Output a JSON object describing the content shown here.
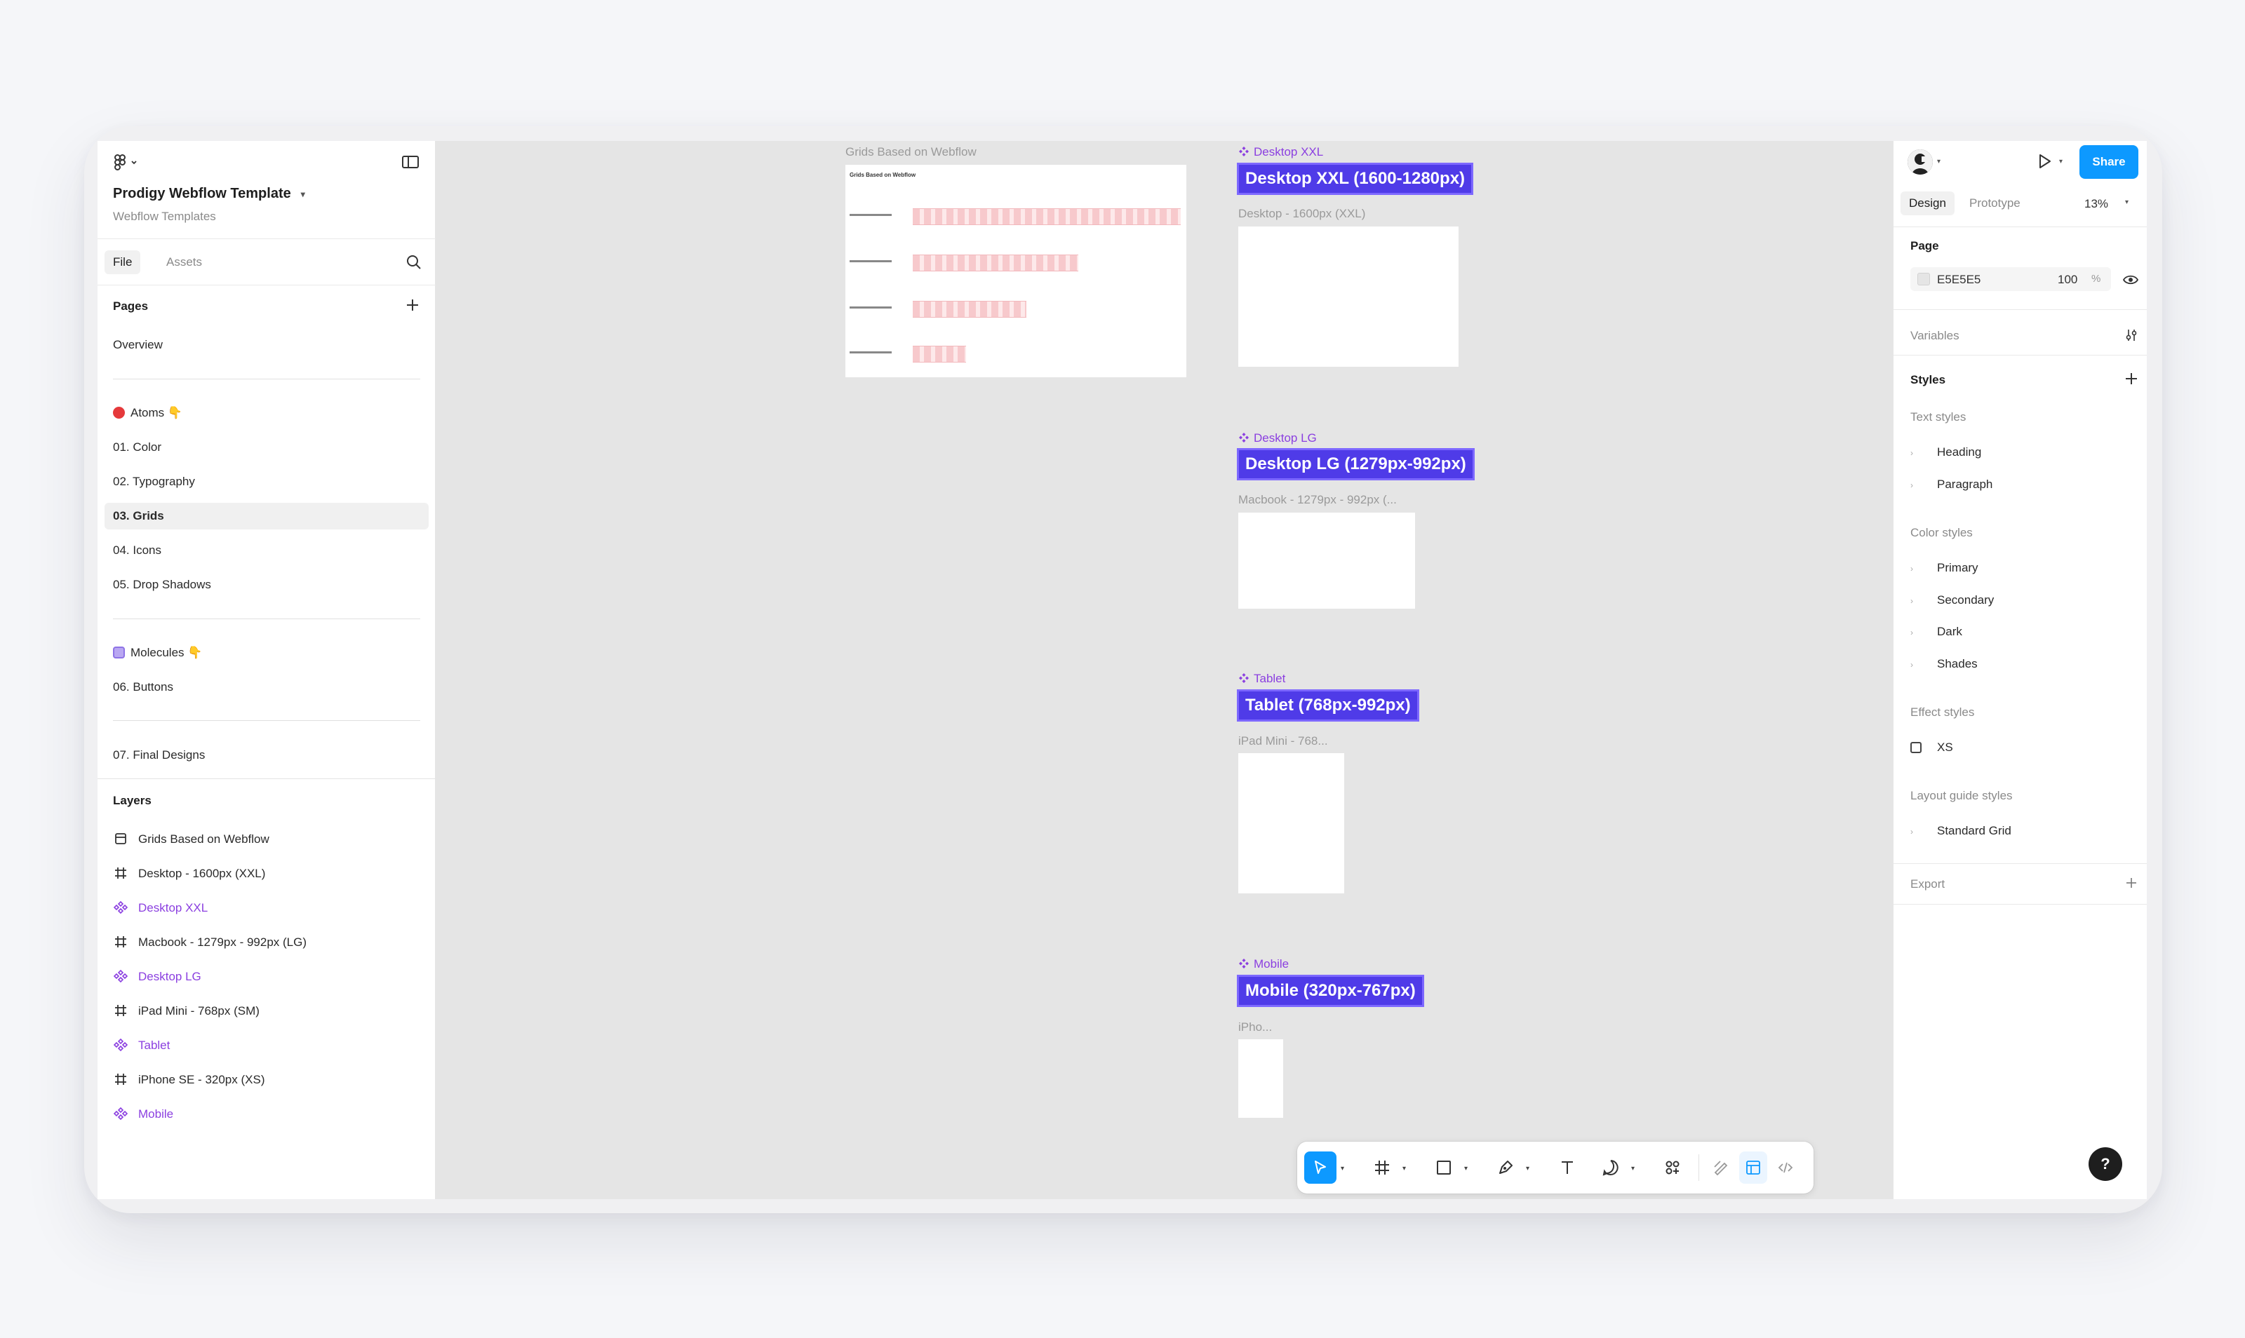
{
  "left_panel": {
    "file_title": "Prodigy Webflow Template",
    "file_subtitle": "Webflow Templates",
    "tabs": [
      "File",
      "Assets"
    ],
    "pages_heading": "Pages",
    "pages": [
      {
        "label": "Overview"
      },
      {
        "label": "Atoms 👇"
      },
      {
        "label": "01. Color"
      },
      {
        "label": "02. Typography"
      },
      {
        "label": "03. Grids",
        "selected": true
      },
      {
        "label": "04. Icons"
      },
      {
        "label": "05.  Drop Shadows"
      },
      {
        "label": "Molecules 👇"
      },
      {
        "label": "06. Buttons"
      },
      {
        "label": "07. Final Designs"
      }
    ],
    "layers_heading": "Layers",
    "layers": [
      {
        "label": "Grids Based on Webflow",
        "icon": "section-icon"
      },
      {
        "label": "Desktop - 1600px (XXL)",
        "icon": "frame-icon"
      },
      {
        "label": "Desktop XXL",
        "icon": "component-icon"
      },
      {
        "label": "Macbook - 1279px - 992px (LG)",
        "icon": "frame-icon"
      },
      {
        "label": "Desktop LG",
        "icon": "component-icon"
      },
      {
        "label": "iPad Mini - 768px (SM)",
        "icon": "frame-icon"
      },
      {
        "label": "Tablet",
        "icon": "component-icon"
      },
      {
        "label": "iPhone SE - 320px (XS)",
        "icon": "frame-icon"
      },
      {
        "label": "Mobile",
        "icon": "component-icon"
      }
    ]
  },
  "canvas": {
    "section_label": "Grids Based on Webflow",
    "thumb_title": "Grids Based on Webflow",
    "breakpoints": [
      {
        "component": "Desktop XXL",
        "label": "Desktop XXL (1600-1280px)",
        "frame": "Desktop - 1600px (XXL)"
      },
      {
        "component": "Desktop LG",
        "label": "Desktop LG (1279px-992px)",
        "frame": "Macbook - 1279px - 992px (..."
      },
      {
        "component": "Tablet",
        "label": "Tablet (768px-992px)",
        "frame": "iPad Mini - 768..."
      },
      {
        "component": "Mobile",
        "label": "Mobile (320px-767px)",
        "frame": "iPho..."
      }
    ],
    "component_color": "#8b3fe0",
    "label_color": "#4f3be8",
    "canvas_color": "#E5E5E5"
  },
  "toolbar": {
    "tools": [
      "move-tool",
      "frame-tool",
      "shape-tool",
      "pen-tool",
      "text-tool",
      "comment-tool",
      "actions-tool",
      "draw-mode",
      "design-mode",
      "dev-mode"
    ],
    "active_tool": "move-tool",
    "accent": "#0d99ff"
  },
  "right_panel": {
    "share_label": "Share",
    "tabs": [
      "Design",
      "Prototype"
    ],
    "zoom": "13%",
    "page_heading": "Page",
    "page_fill_hex": "E5E5E5",
    "page_fill_opacity": "100",
    "page_fill_unit": "%",
    "variables_label": "Variables",
    "styles_heading": "Styles",
    "text_styles_label": "Text styles",
    "text_styles": [
      "Heading",
      "Paragraph"
    ],
    "color_styles_label": "Color styles",
    "color_styles": [
      "Primary",
      "Secondary",
      "Dark",
      "Shades"
    ],
    "effect_styles_label": "Effect styles",
    "effect_styles": [
      "XS"
    ],
    "layout_guide_label": "Layout guide styles",
    "layout_guides": [
      "Standard Grid"
    ],
    "export_label": "Export",
    "help_label": "?"
  }
}
